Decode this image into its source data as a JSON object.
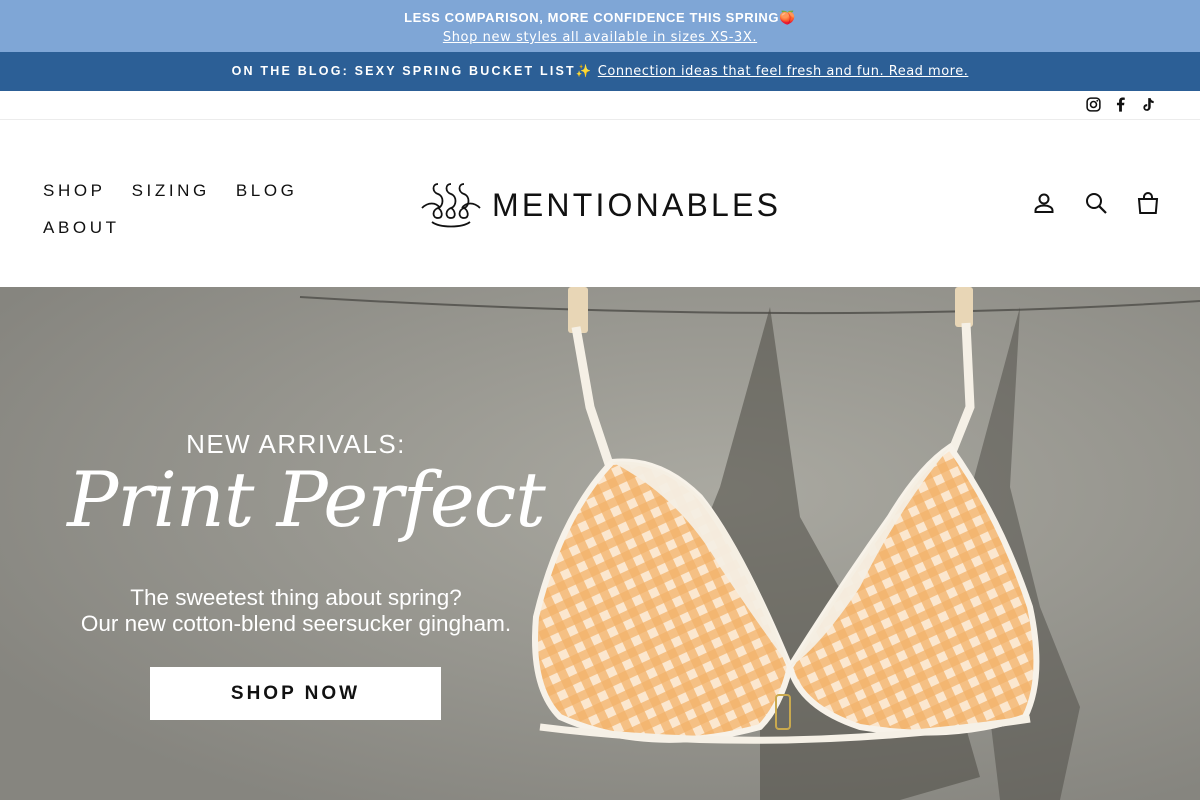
{
  "announcement_primary": {
    "title": "LESS COMPARISON, MORE CONFIDENCE THIS SPRING🍑",
    "link": "Shop new styles all available in sizes XS-3X."
  },
  "announcement_secondary": {
    "prefix": "ON THE BLOG: SEXY SPRING BUCKET LIST✨",
    "link": "Connection ideas that feel fresh and fun. Read more."
  },
  "social": {
    "icons": [
      "instagram-icon",
      "facebook-icon",
      "tiktok-icon"
    ]
  },
  "nav": {
    "items": [
      "SHOP",
      "SIZING",
      "BLOG",
      "ABOUT"
    ]
  },
  "brand": {
    "name": "MENTIONABLES"
  },
  "header_actions": {
    "icons": [
      "account-icon",
      "search-icon",
      "cart-icon"
    ]
  },
  "hero": {
    "eyebrow": "NEW ARRIVALS:",
    "title": "Print Perfect",
    "subtitle_line1": "The sweetest thing about spring?",
    "subtitle_line2": "Our new cotton-blend seersucker gingham.",
    "cta": "SHOP NOW"
  },
  "colors": {
    "announcement_primary_bg": "#7fa6d6",
    "announcement_secondary_bg": "#2c5f96",
    "text_dark": "#111111",
    "hero_gingham": "#f2b36a"
  }
}
